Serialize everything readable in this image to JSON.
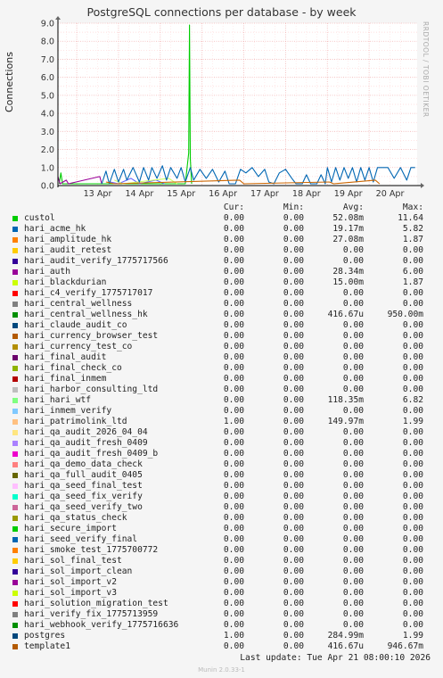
{
  "title": "PostgreSQL connections per database - by week",
  "side_label": "RRDTOOL / TOBI OETIKER",
  "chart_data": {
    "type": "line",
    "title": "PostgreSQL connections per database - by week",
    "ylabel": "Connections",
    "xlabel": "",
    "ylim": [
      0,
      9
    ],
    "yticks": [
      "0.0",
      "1.0",
      "2.0",
      "3.0",
      "4.0",
      "5.0",
      "6.0",
      "7.0",
      "8.0",
      "9.0"
    ],
    "xticks": [
      "13 Apr",
      "14 Apr",
      "15 Apr",
      "16 Apr",
      "17 Apr",
      "18 Apr",
      "19 Apr",
      "20 Apr"
    ],
    "xrange_days": [
      12.55,
      21.15
    ],
    "grid": true,
    "series": [
      {
        "name": "custol",
        "color": "#00cc00",
        "points": [
          [
            12.58,
            0.1
          ],
          [
            12.62,
            0.7
          ],
          [
            12.66,
            0.1
          ],
          [
            15.6,
            0.1
          ],
          [
            15.68,
            1.8
          ],
          [
            15.7,
            8.9
          ],
          [
            15.72,
            1.5
          ],
          [
            15.75,
            0.1
          ]
        ]
      },
      {
        "name": "hari_auth",
        "color": "#990099",
        "points": [
          [
            12.55,
            0.5
          ],
          [
            12.6,
            0.1
          ],
          [
            12.75,
            0.3
          ],
          [
            12.8,
            0.1
          ],
          [
            13.55,
            0.5
          ],
          [
            13.6,
            0.1
          ]
        ]
      },
      {
        "name": "hari_patrimolink_ltd",
        "color": "#6666ff",
        "points": [
          [
            13.8,
            0.2
          ],
          [
            14.0,
            0.1
          ],
          [
            14.3,
            0.4
          ],
          [
            14.5,
            0.1
          ],
          [
            14.9,
            0.3
          ],
          [
            15.1,
            0.1
          ]
        ]
      },
      {
        "name": "hari_hari_wtf",
        "color": "#ccff66",
        "points": [
          [
            13.9,
            0.3
          ],
          [
            14.1,
            0.1
          ],
          [
            15.2,
            0.4
          ],
          [
            15.4,
            0.1
          ]
        ]
      },
      {
        "name": "postgres",
        "color": "#0066b3",
        "points": [
          [
            13.6,
            0.1
          ],
          [
            13.7,
            0.8
          ],
          [
            13.78,
            0.1
          ],
          [
            13.9,
            0.9
          ],
          [
            14.0,
            0.2
          ],
          [
            14.12,
            0.9
          ],
          [
            14.2,
            0.3
          ],
          [
            14.35,
            1.0
          ],
          [
            14.5,
            0.2
          ],
          [
            14.6,
            1.0
          ],
          [
            14.72,
            0.3
          ],
          [
            14.8,
            1.0
          ],
          [
            14.92,
            0.4
          ],
          [
            15.05,
            1.1
          ],
          [
            15.15,
            0.3
          ],
          [
            15.25,
            1.0
          ],
          [
            15.4,
            0.4
          ],
          [
            15.5,
            1.0
          ],
          [
            15.6,
            0.2
          ],
          [
            15.72,
            1.0
          ],
          [
            15.8,
            0.3
          ],
          [
            15.95,
            0.9
          ],
          [
            16.1,
            0.4
          ],
          [
            16.25,
            0.9
          ],
          [
            16.4,
            0.2
          ],
          [
            16.55,
            0.8
          ],
          [
            16.65,
            0.1
          ],
          [
            16.8,
            0.1
          ],
          [
            16.92,
            0.9
          ],
          [
            17.05,
            0.7
          ],
          [
            17.2,
            1.0
          ],
          [
            17.35,
            0.5
          ],
          [
            17.5,
            0.9
          ],
          [
            17.6,
            0.2
          ],
          [
            17.72,
            0.1
          ],
          [
            17.85,
            0.7
          ],
          [
            18.0,
            0.9
          ],
          [
            18.15,
            0.4
          ],
          [
            18.25,
            0.1
          ],
          [
            18.4,
            0.1
          ],
          [
            18.5,
            0.6
          ],
          [
            18.6,
            0.1
          ],
          [
            18.75,
            0.1
          ],
          [
            18.85,
            0.6
          ],
          [
            18.95,
            0.1
          ],
          [
            19.0,
            1.0
          ],
          [
            19.1,
            0.2
          ],
          [
            19.2,
            1.0
          ],
          [
            19.3,
            0.3
          ],
          [
            19.4,
            1.0
          ],
          [
            19.5,
            0.4
          ],
          [
            19.6,
            1.0
          ],
          [
            19.7,
            0.2
          ],
          [
            19.8,
            1.0
          ],
          [
            19.9,
            0.3
          ],
          [
            20.0,
            1.0
          ],
          [
            20.1,
            0.2
          ],
          [
            20.2,
            1.0
          ],
          [
            20.3,
            1.0
          ],
          [
            20.45,
            1.0
          ],
          [
            20.6,
            0.4
          ],
          [
            20.75,
            1.0
          ],
          [
            20.9,
            0.3
          ],
          [
            21.0,
            1.0
          ],
          [
            21.1,
            1.0
          ]
        ]
      },
      {
        "name": "template1",
        "color": "#cc6600",
        "points": [
          [
            13.7,
            0.2
          ],
          [
            13.9,
            0.1
          ],
          [
            16.9,
            0.3
          ],
          [
            17.0,
            0.1
          ],
          [
            19.05,
            0.2
          ],
          [
            19.15,
            0.1
          ],
          [
            20.15,
            0.3
          ],
          [
            20.25,
            0.1
          ]
        ]
      }
    ]
  },
  "legend": {
    "headers": {
      "cur": "Cur:",
      "min": "Min:",
      "avg": "Avg:",
      "max": "Max:"
    },
    "rows": [
      {
        "name": "custol",
        "color": "#00cc00",
        "cur": "0.00",
        "min": "0.00",
        "avg": "52.08m",
        "max": "11.64"
      },
      {
        "name": "hari_acme_hk",
        "color": "#0066b3",
        "cur": "0.00",
        "min": "0.00",
        "avg": "19.17m",
        "max": "5.82"
      },
      {
        "name": "hari_amplitude_hk",
        "color": "#ff8000",
        "cur": "0.00",
        "min": "0.00",
        "avg": "27.08m",
        "max": "1.87"
      },
      {
        "name": "hari_audit_retest",
        "color": "#ffcc00",
        "cur": "0.00",
        "min": "0.00",
        "avg": "0.00",
        "max": "0.00"
      },
      {
        "name": "hari_audit_verify_1775717566",
        "color": "#330099",
        "cur": "0.00",
        "min": "0.00",
        "avg": "0.00",
        "max": "0.00"
      },
      {
        "name": "hari_auth",
        "color": "#990099",
        "cur": "0.00",
        "min": "0.00",
        "avg": "28.34m",
        "max": "6.00"
      },
      {
        "name": "hari_blackdurian",
        "color": "#ccff00",
        "cur": "0.00",
        "min": "0.00",
        "avg": "15.00m",
        "max": "1.87"
      },
      {
        "name": "hari_c4_verify_1775717017",
        "color": "#ff0000",
        "cur": "0.00",
        "min": "0.00",
        "avg": "0.00",
        "max": "0.00"
      },
      {
        "name": "hari_central_wellness",
        "color": "#808080",
        "cur": "0.00",
        "min": "0.00",
        "avg": "0.00",
        "max": "0.00"
      },
      {
        "name": "hari_central_wellness_hk",
        "color": "#008f00",
        "cur": "0.00",
        "min": "0.00",
        "avg": "416.67u",
        "max": "950.00m"
      },
      {
        "name": "hari_claude_audit_co",
        "color": "#00487d",
        "cur": "0.00",
        "min": "0.00",
        "avg": "0.00",
        "max": "0.00"
      },
      {
        "name": "hari_currency_browser_test",
        "color": "#b35a00",
        "cur": "0.00",
        "min": "0.00",
        "avg": "0.00",
        "max": "0.00"
      },
      {
        "name": "hari_currency_test_co",
        "color": "#b38f00",
        "cur": "0.00",
        "min": "0.00",
        "avg": "0.00",
        "max": "0.00"
      },
      {
        "name": "hari_final_audit",
        "color": "#6b006b",
        "cur": "0.00",
        "min": "0.00",
        "avg": "0.00",
        "max": "0.00"
      },
      {
        "name": "hari_final_check_co",
        "color": "#8fb300",
        "cur": "0.00",
        "min": "0.00",
        "avg": "0.00",
        "max": "0.00"
      },
      {
        "name": "hari_final_inmem",
        "color": "#b30000",
        "cur": "0.00",
        "min": "0.00",
        "avg": "0.00",
        "max": "0.00"
      },
      {
        "name": "hari_harbor_consulting_ltd",
        "color": "#bebebe",
        "cur": "0.00",
        "min": "0.00",
        "avg": "0.00",
        "max": "0.00"
      },
      {
        "name": "hari_hari_wtf",
        "color": "#80ff80",
        "cur": "0.00",
        "min": "0.00",
        "avg": "118.35m",
        "max": "6.82"
      },
      {
        "name": "hari_inmem_verify",
        "color": "#80c9ff",
        "cur": "0.00",
        "min": "0.00",
        "avg": "0.00",
        "max": "0.00"
      },
      {
        "name": "hari_patrimolink_ltd",
        "color": "#ffc080",
        "cur": "1.00",
        "min": "0.00",
        "avg": "149.97m",
        "max": "1.99"
      },
      {
        "name": "hari_qa_audit_2026_04_04",
        "color": "#ffe680",
        "cur": "0.00",
        "min": "0.00",
        "avg": "0.00",
        "max": "0.00"
      },
      {
        "name": "hari_qa_audit_fresh_0409",
        "color": "#aa80ff",
        "cur": "0.00",
        "min": "0.00",
        "avg": "0.00",
        "max": "0.00"
      },
      {
        "name": "hari_qa_audit_fresh_0409_b",
        "color": "#ee00cc",
        "cur": "0.00",
        "min": "0.00",
        "avg": "0.00",
        "max": "0.00"
      },
      {
        "name": "hari_qa_demo_data_check",
        "color": "#ff8080",
        "cur": "0.00",
        "min": "0.00",
        "avg": "0.00",
        "max": "0.00"
      },
      {
        "name": "hari_qa_full_audit_0405",
        "color": "#666600",
        "cur": "0.00",
        "min": "0.00",
        "avg": "0.00",
        "max": "0.00"
      },
      {
        "name": "hari_qa_seed_final_test",
        "color": "#ffbfff",
        "cur": "0.00",
        "min": "0.00",
        "avg": "0.00",
        "max": "0.00"
      },
      {
        "name": "hari_qa_seed_fix_verify",
        "color": "#00ffcc",
        "cur": "0.00",
        "min": "0.00",
        "avg": "0.00",
        "max": "0.00"
      },
      {
        "name": "hari_qa_seed_verify_two",
        "color": "#cc6699",
        "cur": "0.00",
        "min": "0.00",
        "avg": "0.00",
        "max": "0.00"
      },
      {
        "name": "hari_qa_status_check",
        "color": "#999900",
        "cur": "0.00",
        "min": "0.00",
        "avg": "0.00",
        "max": "0.00"
      },
      {
        "name": "hari_secure_import",
        "color": "#00cc00",
        "cur": "0.00",
        "min": "0.00",
        "avg": "0.00",
        "max": "0.00"
      },
      {
        "name": "hari_seed_verify_final",
        "color": "#0066b3",
        "cur": "0.00",
        "min": "0.00",
        "avg": "0.00",
        "max": "0.00"
      },
      {
        "name": "hari_smoke_test_1775700772",
        "color": "#ff8000",
        "cur": "0.00",
        "min": "0.00",
        "avg": "0.00",
        "max": "0.00"
      },
      {
        "name": "hari_sol_final_test",
        "color": "#ffcc00",
        "cur": "0.00",
        "min": "0.00",
        "avg": "0.00",
        "max": "0.00"
      },
      {
        "name": "hari_sol_import_clean",
        "color": "#330099",
        "cur": "0.00",
        "min": "0.00",
        "avg": "0.00",
        "max": "0.00"
      },
      {
        "name": "hari_sol_import_v2",
        "color": "#990099",
        "cur": "0.00",
        "min": "0.00",
        "avg": "0.00",
        "max": "0.00"
      },
      {
        "name": "hari_sol_import_v3",
        "color": "#ccff00",
        "cur": "0.00",
        "min": "0.00",
        "avg": "0.00",
        "max": "0.00"
      },
      {
        "name": "hari_solution_migration_test",
        "color": "#ff0000",
        "cur": "0.00",
        "min": "0.00",
        "avg": "0.00",
        "max": "0.00"
      },
      {
        "name": "hari_verify_fix_1775713959",
        "color": "#808080",
        "cur": "0.00",
        "min": "0.00",
        "avg": "0.00",
        "max": "0.00"
      },
      {
        "name": "hari_webhook_verify_1775716636",
        "color": "#008f00",
        "cur": "0.00",
        "min": "0.00",
        "avg": "0.00",
        "max": "0.00"
      },
      {
        "name": "postgres",
        "color": "#00487d",
        "cur": "1.00",
        "min": "0.00",
        "avg": "284.99m",
        "max": "1.99"
      },
      {
        "name": "template1",
        "color": "#b35a00",
        "cur": "0.00",
        "min": "0.00",
        "avg": "416.67u",
        "max": "946.67m"
      }
    ]
  },
  "last_update": "Last update:  Tue Apr 21 08:00:10 2026",
  "footer": "Munin 2.0.33-1"
}
